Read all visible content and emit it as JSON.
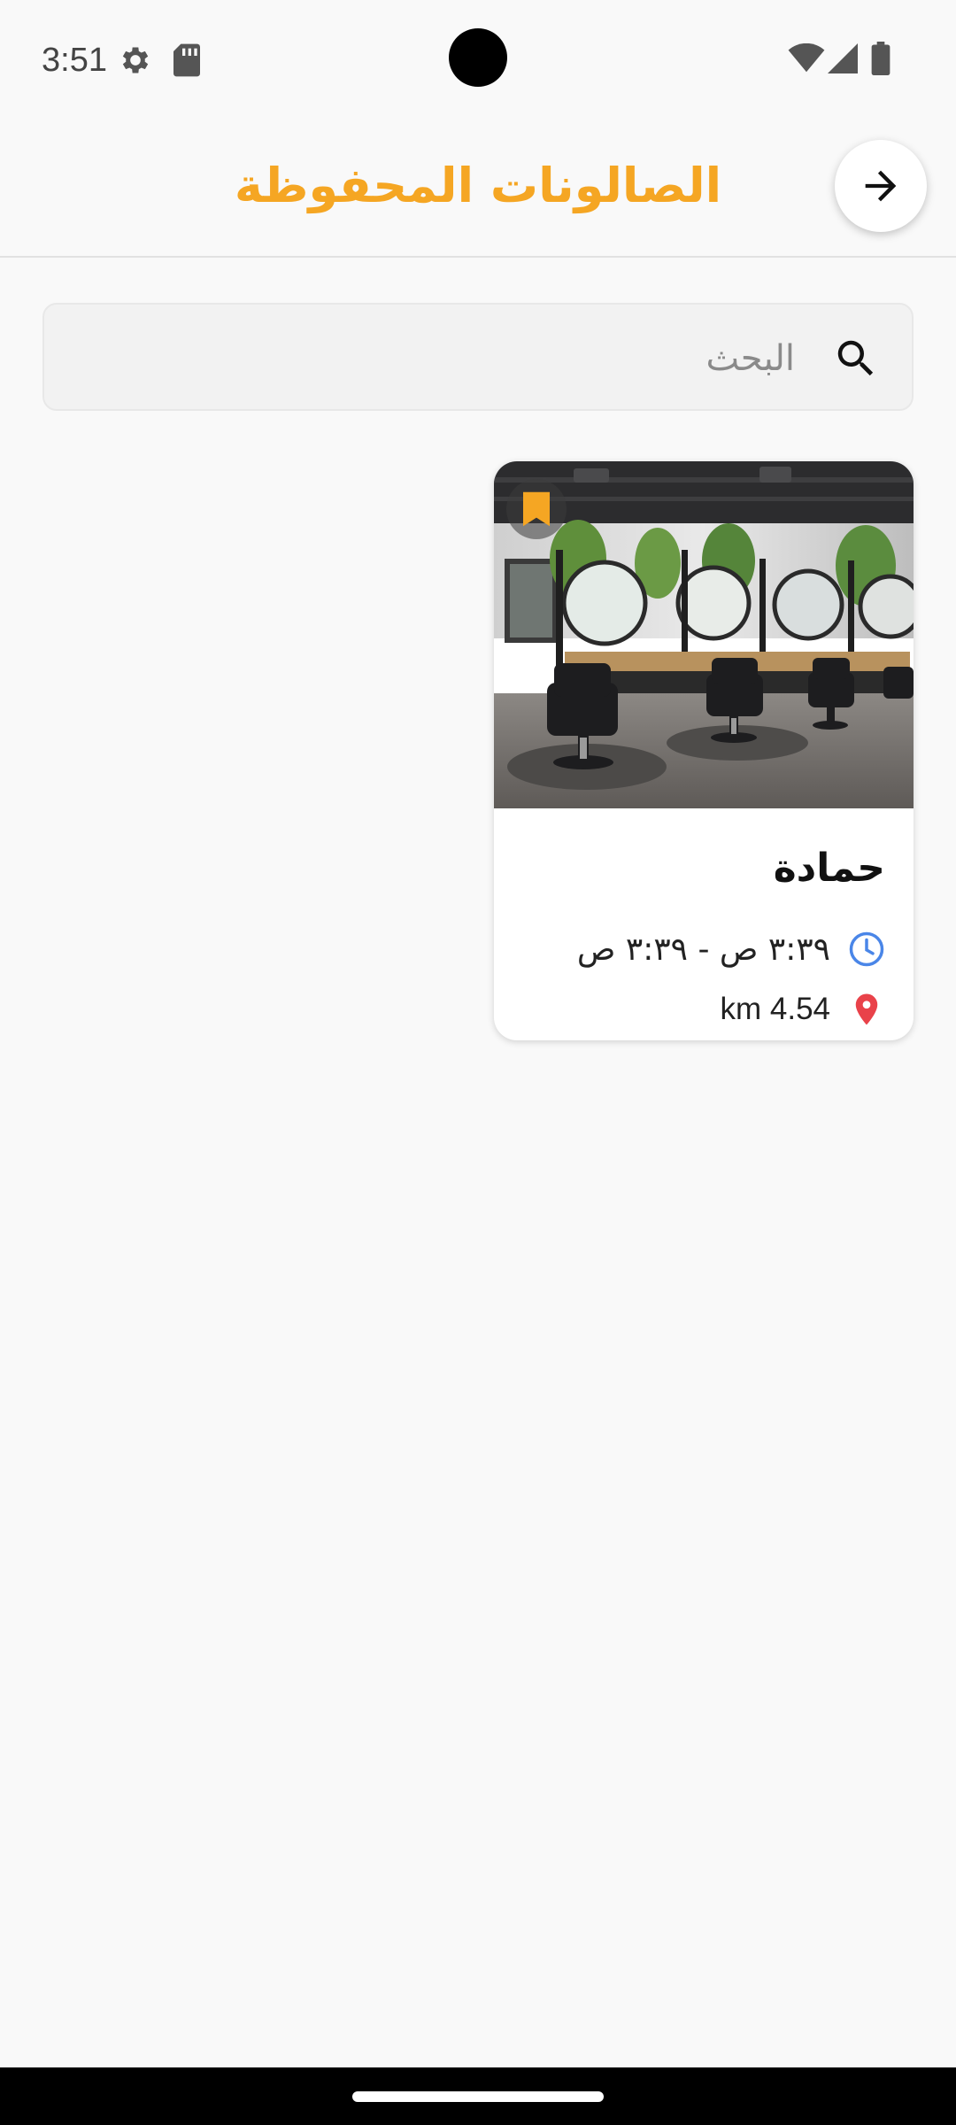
{
  "status_bar": {
    "time": "3:51",
    "icons": [
      "gear-icon",
      "sd-card-icon",
      "wifi-icon",
      "cell-signal-icon",
      "battery-icon"
    ]
  },
  "header": {
    "title": "الصالونات المحفوظة",
    "title_color": "#f5a623",
    "back_icon": "arrow-right-icon"
  },
  "search": {
    "placeholder": "البحث",
    "value": "",
    "icon": "search-icon"
  },
  "salons": [
    {
      "name": "حمادة",
      "hours": "٣:٣٩ ص - ٣:٣٩ ص",
      "distance": "4.54 km",
      "saved": true,
      "photo": "salon-interior-photo"
    }
  ],
  "colors": {
    "accent": "#f5a623",
    "clock_icon": "#4a86e8",
    "location_icon": "#e9424a"
  }
}
